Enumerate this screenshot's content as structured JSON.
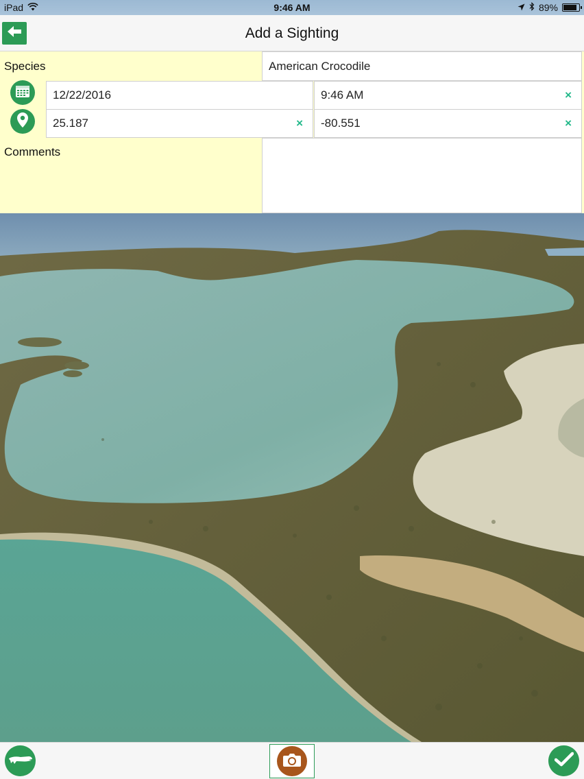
{
  "status_bar": {
    "device": "iPad",
    "time": "9:46 AM",
    "battery_pct": "89%",
    "battery_level": 0.89,
    "icons": [
      "wifi-icon",
      "location-arrow-icon",
      "bluetooth-icon",
      "battery-icon"
    ]
  },
  "nav": {
    "title": "Add a Sighting",
    "back_icon": "back-arrow-icon"
  },
  "form": {
    "species_label": "Species",
    "species_value": "American Crocodile",
    "date_value": "12/22/2016",
    "time_value": "9:46 AM",
    "latitude_value": "25.187",
    "longitude_value": "-80.551",
    "clear_glyph": "×",
    "comments_label": "Comments",
    "comments_value": ""
  },
  "photo": {
    "icon": "aerial-photo-image"
  },
  "toolbar": {
    "left_icon": "crocodile-icon",
    "center_icon": "camera-icon",
    "right_icon": "checkmark-icon"
  },
  "colors": {
    "accent_green": "#2c9b56",
    "clear_teal": "#23b88a",
    "form_yellow": "#ffffcc",
    "camera_brown": "#a8561c"
  }
}
